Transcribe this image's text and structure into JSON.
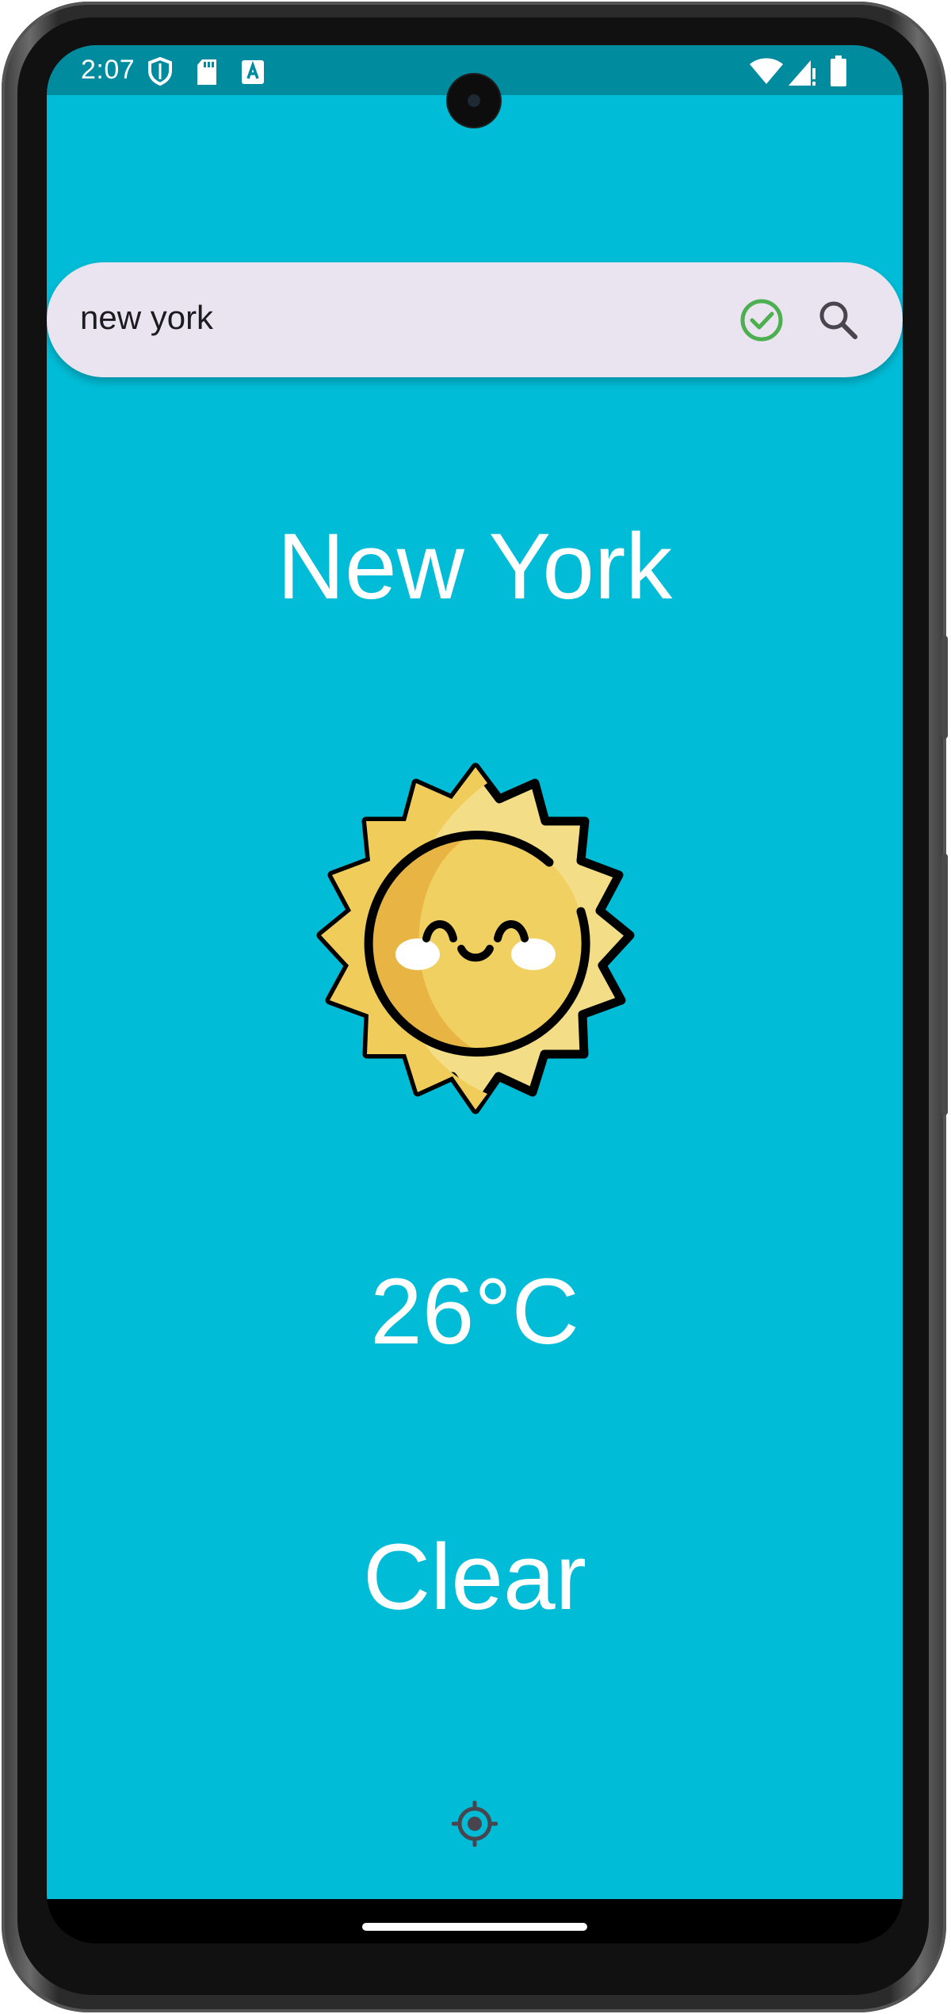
{
  "status_bar": {
    "time": "2:07",
    "icons": [
      "shield-icon",
      "sd-card-icon",
      "keyboard-a-icon",
      "wifi-icon",
      "signal-icon",
      "battery-icon"
    ]
  },
  "search": {
    "value": "new york",
    "valid_icon": "check-circle-icon",
    "valid_color": "#4caf50",
    "action_icon": "search-icon"
  },
  "weather": {
    "city": "New York",
    "icon": "smiling-sun-icon",
    "temperature": "26°C",
    "condition": "Clear"
  },
  "location_button_icon": "my-location-icon",
  "colors": {
    "app_background": "#00bcd6",
    "status_bar": "#008b9f",
    "search_bar": "#e9e4ef",
    "text": "#ffffff"
  }
}
